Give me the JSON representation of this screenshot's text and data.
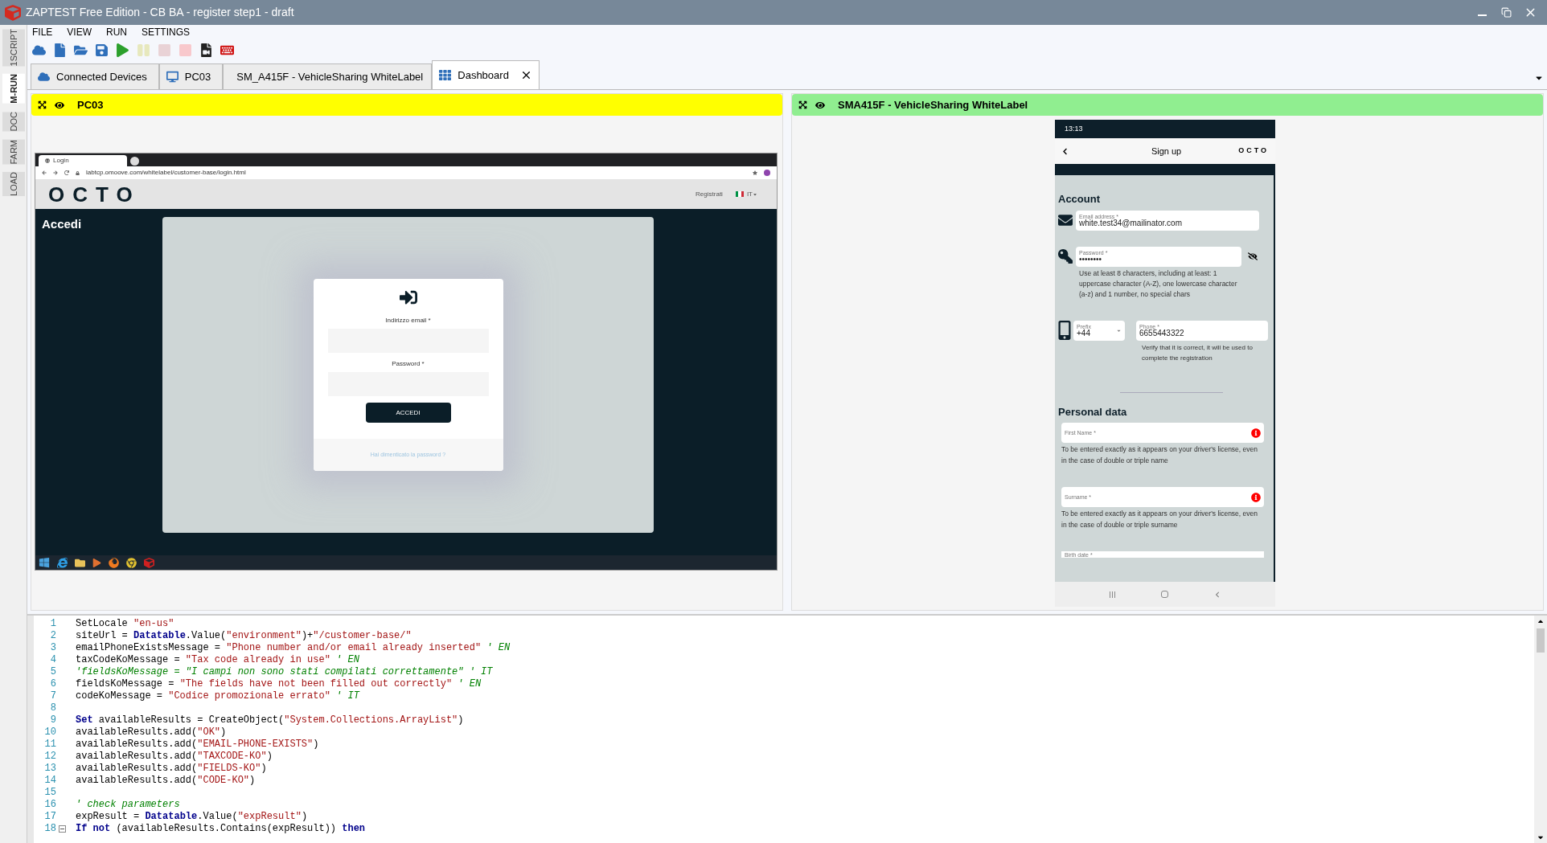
{
  "window": {
    "title": "ZAPTEST Free Edition - CB BA - register step1 - draft"
  },
  "side_tabs": [
    {
      "label": "1SCRIPT",
      "selected": false
    },
    {
      "label": "M-RUN",
      "selected": true
    },
    {
      "label": "DOC",
      "selected": false
    },
    {
      "label": "FARM",
      "selected": false
    },
    {
      "label": "LOAD",
      "selected": false
    }
  ],
  "menu": [
    "FILE",
    "VIEW",
    "RUN",
    "SETTINGS"
  ],
  "toolbar": [
    {
      "kind": "cloud",
      "disabled": false
    },
    {
      "kind": "new",
      "disabled": false
    },
    {
      "kind": "open",
      "disabled": false
    },
    {
      "kind": "save",
      "disabled": false
    },
    {
      "kind": "run",
      "disabled": false
    },
    {
      "kind": "pause",
      "disabled": true
    },
    {
      "kind": "stop",
      "disabled": true
    },
    {
      "kind": "halt",
      "disabled": true
    },
    {
      "kind": "record",
      "disabled": false
    },
    {
      "kind": "keyboard",
      "disabled": false
    }
  ],
  "tabs": [
    {
      "label": "Connected Devices",
      "selected": false,
      "closable": false
    },
    {
      "label": "PC03",
      "selected": false,
      "closable": false
    },
    {
      "label": "SM_A415F - VehicleSharing WhiteLabel",
      "selected": false,
      "closable": false
    },
    {
      "label": "Dashboard",
      "selected": true,
      "closable": true
    }
  ],
  "panels": [
    {
      "title": "PC03",
      "color": "#ffff00",
      "kind": "desktop"
    },
    {
      "title": "SMA415F - VehicleSharing WhiteLabel",
      "color": "#90ee90",
      "kind": "mobile"
    }
  ],
  "pc_screen": {
    "browser_tab": "Login",
    "url": "labtcp.omoove.com/whitelabel/customer-base/login.html",
    "logo": "OCTO",
    "register_link": "Registrati",
    "language": "IT",
    "page_title": "Accedi",
    "email_label": "Indirizzo email *",
    "password_label": "Password *",
    "submit": "ACCEDI",
    "forgot_link": "Hai dimenticato la password ?"
  },
  "phone": {
    "time": "13:13",
    "title": "Sign up",
    "logo": "OCTO",
    "account_heading": "Account",
    "email_label": "Email address *",
    "email_value": "white.test34@mailinator.com",
    "password_label": "Password *",
    "password_value": "••••••••",
    "password_hint": "Use at least 8 characters, including at least: 1 uppercase character (A-Z), one lowercase character (a-z) and 1 number, no special chars",
    "prefix_label": "Prefix",
    "prefix_value": "+44",
    "phone_label": "Phone *",
    "phone_value": "6655443322",
    "phone_hint": "Verify that it is correct, it will be used to complete the registration",
    "personal_heading": "Personal data",
    "first_name_label": "First Name *",
    "first_name_hint": "To be entered exactly as it appears on your driver's license, even in the case of double or triple name",
    "surname_label": "Surname *",
    "surname_hint": "To be entered exactly as it appears on your driver's license, even in the case of double or triple surname",
    "birth_label": "Birth date *"
  },
  "editor": {
    "lines": [
      {
        "number": "1",
        "fold": false,
        "tokens": [
          {
            "kind": "plain",
            "text": "SetLocale "
          },
          {
            "kind": "string",
            "text": "\"en-us\""
          }
        ]
      },
      {
        "number": "2",
        "fold": false,
        "tokens": [
          {
            "kind": "plain",
            "text": "siteUrl = "
          },
          {
            "kind": "keyword",
            "text": "Datatable"
          },
          {
            "kind": "plain",
            "text": ".Value("
          },
          {
            "kind": "string",
            "text": "\"environment\""
          },
          {
            "kind": "plain",
            "text": ")+"
          },
          {
            "kind": "string",
            "text": "\"/customer-base/\""
          }
        ]
      },
      {
        "number": "3",
        "fold": false,
        "tokens": [
          {
            "kind": "plain",
            "text": "emailPhoneExistsMessage = "
          },
          {
            "kind": "string",
            "text": "\"Phone number and/or email already inserted\""
          },
          {
            "kind": "comment",
            "text": " ' EN"
          }
        ]
      },
      {
        "number": "4",
        "fold": false,
        "tokens": [
          {
            "kind": "plain",
            "text": "taxCodeKoMessage = "
          },
          {
            "kind": "string",
            "text": "\"Tax code already in use\""
          },
          {
            "kind": "comment",
            "text": " ' EN"
          }
        ]
      },
      {
        "number": "5",
        "fold": false,
        "tokens": [
          {
            "kind": "comment",
            "text": "'fieldsKoMessage = \"I campi non sono stati compilati correttamente\" ' IT"
          }
        ]
      },
      {
        "number": "6",
        "fold": false,
        "tokens": [
          {
            "kind": "plain",
            "text": "fieldsKoMessage = "
          },
          {
            "kind": "string",
            "text": "\"The fields have not been filled out correctly\""
          },
          {
            "kind": "comment",
            "text": " ' EN"
          }
        ]
      },
      {
        "number": "7",
        "fold": false,
        "tokens": [
          {
            "kind": "plain",
            "text": "codeKoMessage = "
          },
          {
            "kind": "string",
            "text": "\"Codice promozionale errato\""
          },
          {
            "kind": "comment",
            "text": " ' IT"
          }
        ]
      },
      {
        "number": "8",
        "fold": false
      },
      {
        "number": "9",
        "fold": false,
        "tokens": [
          {
            "kind": "keyword",
            "text": "Set"
          },
          {
            "kind": "plain",
            "text": " availableResults = CreateObject("
          },
          {
            "kind": "string",
            "text": "\"System.Collections.ArrayList\""
          },
          {
            "kind": "plain",
            "text": ")"
          }
        ]
      },
      {
        "number": "10",
        "fold": false,
        "tokens": [
          {
            "kind": "plain",
            "text": "availableResults.add("
          },
          {
            "kind": "string",
            "text": "\"OK\""
          },
          {
            "kind": "plain",
            "text": ")"
          }
        ]
      },
      {
        "number": "11",
        "fold": false,
        "tokens": [
          {
            "kind": "plain",
            "text": "availableResults.add("
          },
          {
            "kind": "string",
            "text": "\"EMAIL-PHONE-EXISTS\""
          },
          {
            "kind": "plain",
            "text": ")"
          }
        ]
      },
      {
        "number": "12",
        "fold": false,
        "tokens": [
          {
            "kind": "plain",
            "text": "availableResults.add("
          },
          {
            "kind": "string",
            "text": "\"TAXCODE-KO\""
          },
          {
            "kind": "plain",
            "text": ")"
          }
        ]
      },
      {
        "number": "13",
        "fold": false,
        "tokens": [
          {
            "kind": "plain",
            "text": "availableResults.add("
          },
          {
            "kind": "string",
            "text": "\"FIELDS-KO\""
          },
          {
            "kind": "plain",
            "text": ")"
          }
        ]
      },
      {
        "number": "14",
        "fold": false,
        "tokens": [
          {
            "kind": "plain",
            "text": "availableResults.add("
          },
          {
            "kind": "string",
            "text": "\"CODE-KO\""
          },
          {
            "kind": "plain",
            "text": ")"
          }
        ]
      },
      {
        "number": "15",
        "fold": false
      },
      {
        "number": "16",
        "fold": false,
        "tokens": [
          {
            "kind": "comment",
            "text": "' check parameters"
          }
        ]
      },
      {
        "number": "17",
        "fold": false,
        "tokens": [
          {
            "kind": "plain",
            "text": "expResult = "
          },
          {
            "kind": "keyword",
            "text": "Datatable"
          },
          {
            "kind": "plain",
            "text": ".Value("
          },
          {
            "kind": "string",
            "text": "\"expResult\""
          },
          {
            "kind": "plain",
            "text": ")"
          }
        ]
      },
      {
        "number": "18",
        "fold": true,
        "tokens": [
          {
            "kind": "keyword",
            "text": "If not"
          },
          {
            "kind": "plain",
            "text": " (availableResults.Contains(expResult)) "
          },
          {
            "kind": "keyword",
            "text": "then"
          }
        ]
      }
    ]
  }
}
